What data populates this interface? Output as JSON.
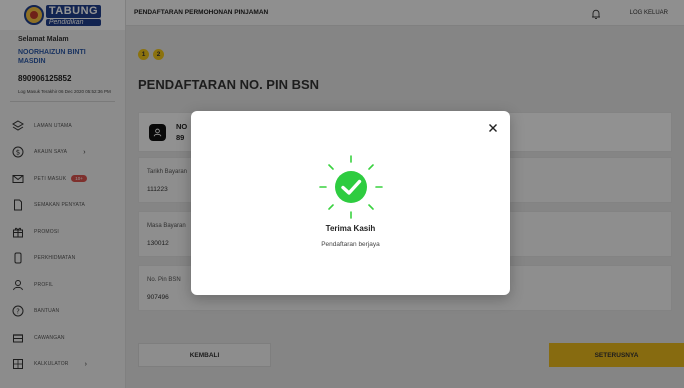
{
  "sidebar": {
    "logo": {
      "line1": "TABUNG",
      "line2": "Pendidikan"
    },
    "greeting": "Selamat Malam",
    "user_name": "NOORHAIZUN BINTI MASDIN",
    "user_ic": "890906125852",
    "last_login": "Log Masuk Terakhir 06 Dec 2020 05:52:36 PM",
    "items": [
      {
        "label": "LAMAN UTAMA",
        "icon": "layers-icon"
      },
      {
        "label": "AKAUN SAYA",
        "icon": "dollar-icon",
        "chevron": "›"
      },
      {
        "label": "PETI MASUK",
        "icon": "mail-icon",
        "badge": "10+"
      },
      {
        "label": "SEMAKAN PENYATA",
        "icon": "document-icon"
      },
      {
        "label": "PROMOSI",
        "icon": "gift-icon"
      },
      {
        "label": "PERKHIDMATAN",
        "icon": "phone-icon"
      },
      {
        "label": "PROFIL",
        "icon": "user-icon"
      },
      {
        "label": "BANTUAN",
        "icon": "help-icon"
      },
      {
        "label": "CAWANGAN",
        "icon": "branch-icon"
      },
      {
        "label": "KALKULATOR",
        "icon": "calculator-icon",
        "chevron": "›"
      }
    ]
  },
  "topbar": {
    "title": "PENDAFTARAN PERMOHONAN PINJAMAN",
    "bell_icon": "bell-icon",
    "logout": "LOG KELUAR"
  },
  "main": {
    "steps": [
      "1",
      "2"
    ],
    "title": "PENDAFTARAN NO. PIN BSN",
    "card": {
      "name": "NO",
      "ic": "89"
    },
    "fields": [
      {
        "label": "Tarikh Bayaran",
        "value": "111223"
      },
      {
        "label": "Masa Bayaran",
        "value": "130012"
      },
      {
        "label": "No. Pin BSN",
        "value": "907496"
      }
    ],
    "back_button": "KEMBALI",
    "next_button": "SETERUSNYA"
  },
  "modal": {
    "title": "Terima Kasih",
    "subtitle": "Pendaftaran berjaya",
    "close_icon": "close-icon",
    "success_icon": "check-circle-icon"
  },
  "colors": {
    "accent": "#e9b81c",
    "success": "#2ecc40",
    "brand": "#1f3f8c",
    "badge": "#d9534f",
    "link": "#2e5aa8"
  }
}
